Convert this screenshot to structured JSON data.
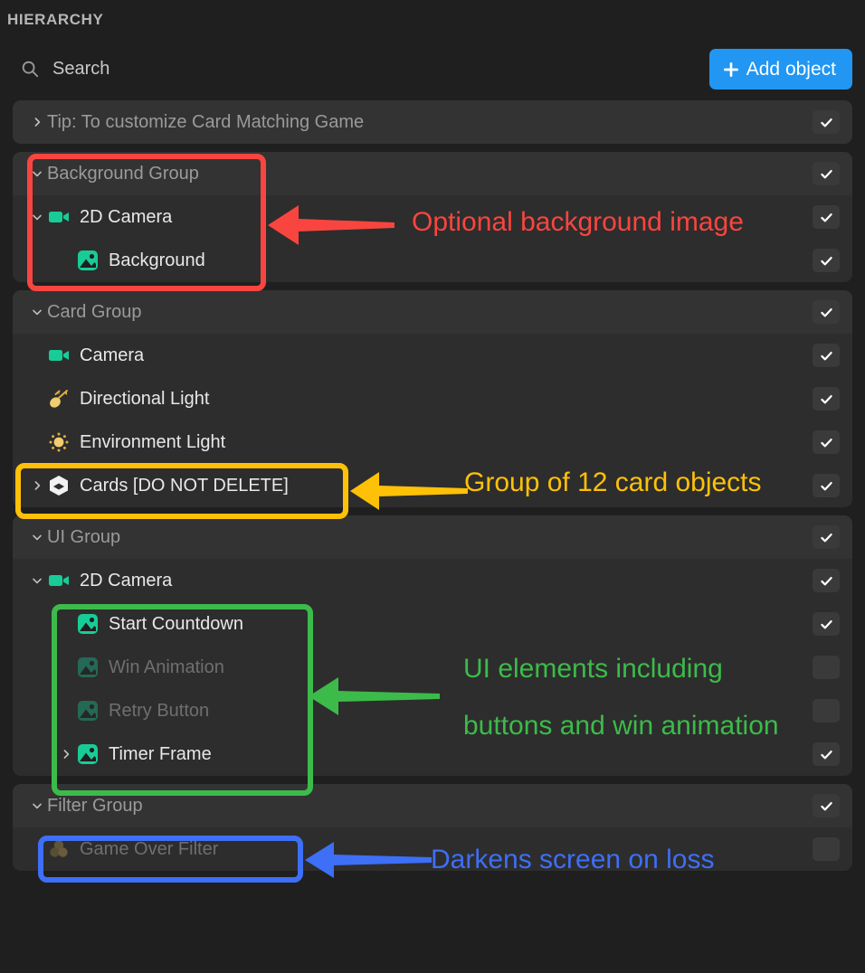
{
  "panel": {
    "title": "HIERARCHY"
  },
  "search": {
    "placeholder": "Search",
    "icon": "search-icon"
  },
  "toolbar": {
    "add_label": "Add object",
    "add_icon": "plus-icon",
    "accent": "#2196f3"
  },
  "colors": {
    "page_bg": "#1f1f1f",
    "panel_bg": "#2d2d2d",
    "header_row_bg": "#333333",
    "red": "#f9453f",
    "yellow": "#ffc107",
    "green": "#3cbb4a",
    "blue": "#3d6ff7",
    "teal": "#18cc97"
  },
  "groups": [
    {
      "name": "tip-group",
      "rows": [
        {
          "label": "Tip: To customize Card Matching Game",
          "icon": "none",
          "chevron": "right",
          "indent": 0,
          "kind": "group-label",
          "checked": true,
          "dim": false
        }
      ]
    },
    {
      "name": "background-group",
      "rows": [
        {
          "label": "Background Group",
          "icon": "none",
          "chevron": "down",
          "indent": 0,
          "kind": "group-label",
          "checked": true,
          "dim": false
        },
        {
          "label": "2D Camera",
          "icon": "camera-icon",
          "chevron": "down",
          "indent": 0,
          "kind": "item",
          "checked": true,
          "dim": false
        },
        {
          "label": "Background",
          "icon": "image-icon",
          "chevron": "none",
          "indent": 1,
          "kind": "item",
          "checked": true,
          "dim": false
        }
      ]
    },
    {
      "name": "card-group",
      "rows": [
        {
          "label": "Card Group",
          "icon": "none",
          "chevron": "down",
          "indent": 0,
          "kind": "group-label",
          "checked": true,
          "dim": false
        },
        {
          "label": "Camera",
          "icon": "camera-icon",
          "chevron": "none",
          "indent": 0,
          "kind": "item",
          "checked": true,
          "dim": false
        },
        {
          "label": "Directional Light",
          "icon": "directional-light-icon",
          "chevron": "none",
          "indent": 0,
          "kind": "item",
          "checked": true,
          "dim": false
        },
        {
          "label": "Environment Light",
          "icon": "environment-light-icon",
          "chevron": "none",
          "indent": 0,
          "kind": "item",
          "checked": true,
          "dim": false
        },
        {
          "label": "Cards [DO NOT DELETE]",
          "icon": "cube-icon",
          "chevron": "right",
          "indent": 0,
          "kind": "item",
          "checked": true,
          "dim": false
        }
      ]
    },
    {
      "name": "ui-group",
      "rows": [
        {
          "label": "UI Group",
          "icon": "none",
          "chevron": "down",
          "indent": 0,
          "kind": "group-label",
          "checked": true,
          "dim": false
        },
        {
          "label": "2D Camera",
          "icon": "camera-icon",
          "chevron": "down",
          "indent": 0,
          "kind": "item",
          "checked": true,
          "dim": false
        },
        {
          "label": "Start Countdown",
          "icon": "image-icon",
          "chevron": "none",
          "indent": 1,
          "kind": "item",
          "checked": true,
          "dim": false
        },
        {
          "label": "Win Animation",
          "icon": "image-icon",
          "chevron": "none",
          "indent": 1,
          "kind": "item",
          "checked": false,
          "dim": true
        },
        {
          "label": "Retry Button",
          "icon": "image-icon",
          "chevron": "none",
          "indent": 1,
          "kind": "item",
          "checked": false,
          "dim": true
        },
        {
          "label": "Timer Frame",
          "icon": "image-icon",
          "chevron": "right",
          "indent": 1,
          "kind": "item",
          "checked": true,
          "dim": false
        }
      ]
    },
    {
      "name": "filter-group",
      "rows": [
        {
          "label": "Filter Group",
          "icon": "none",
          "chevron": "down",
          "indent": 0,
          "kind": "group-label",
          "checked": true,
          "dim": false
        },
        {
          "label": "Game Over Filter",
          "icon": "filter-circles-icon",
          "chevron": "none",
          "indent": 0,
          "kind": "item",
          "checked": false,
          "dim": true
        }
      ]
    }
  ],
  "annotations": [
    {
      "name": "annotation-background",
      "color": "#f9453f",
      "text": "Optional background image"
    },
    {
      "name": "annotation-cards",
      "color": "#ffc107",
      "text": "Group of 12 card objects"
    },
    {
      "name": "annotation-ui",
      "color": "#3cbb4a",
      "text_line1": "UI elements including",
      "text_line2": "buttons and win animation"
    },
    {
      "name": "annotation-filter",
      "color": "#3d6ff7",
      "text": "Darkens screen on loss"
    }
  ]
}
